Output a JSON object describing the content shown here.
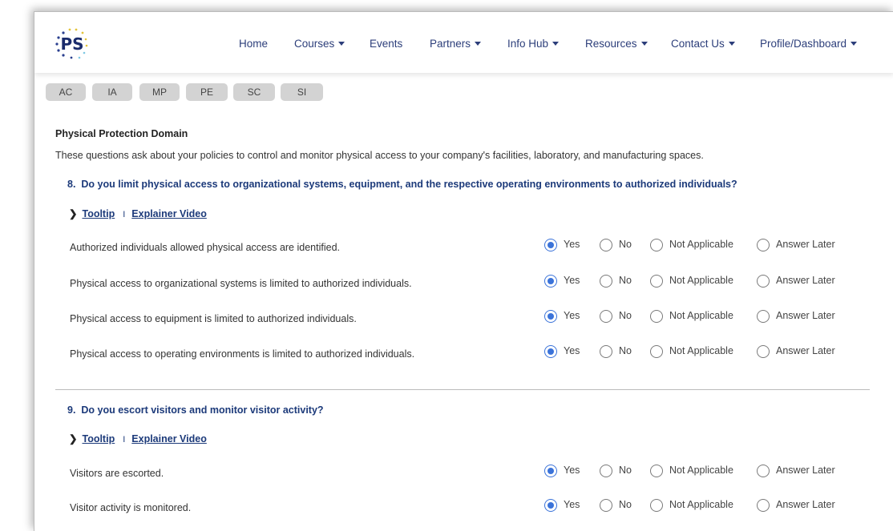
{
  "nav": {
    "logo_text": "PS",
    "items": [
      {
        "label": "Home",
        "dropdown": false
      },
      {
        "label": "Courses",
        "dropdown": true
      },
      {
        "label": "Events",
        "dropdown": false
      },
      {
        "label": "Partners",
        "dropdown": true
      },
      {
        "label": "Info Hub",
        "dropdown": true
      },
      {
        "label": "Resources",
        "dropdown": true
      },
      {
        "label": "Contact Us",
        "dropdown": true
      },
      {
        "label": "Profile/Dashboard",
        "dropdown": true
      }
    ]
  },
  "tabs": [
    "AC",
    "IA",
    "MP",
    "PE",
    "SC",
    "SI"
  ],
  "domain": {
    "title": "Physical Protection Domain",
    "description": "These questions ask about your policies to control and monitor physical access to your company's facilities, laboratory, and manufacturing spaces."
  },
  "options": [
    "Yes",
    "No",
    "Not Applicable",
    "Answer Later"
  ],
  "tooltip_label": "Tooltip",
  "video_label": "Explainer Video",
  "separator": "I",
  "questions": [
    {
      "number": "8.",
      "text": "Do you limit physical access to organizational systems, equipment, and the respective operating environments to authorized individuals?",
      "items": [
        {
          "label": "Authorized individuals allowed physical access are identified.",
          "selected": "Yes"
        },
        {
          "label": "Physical access to organizational systems is limited to authorized individuals.",
          "selected": "Yes"
        },
        {
          "label": "Physical access to equipment is limited to authorized individuals.",
          "selected": "Yes"
        },
        {
          "label": "Physical access to operating environments is limited to authorized individuals.",
          "selected": "Yes"
        }
      ]
    },
    {
      "number": "9.",
      "text": "Do you escort visitors and monitor visitor activity?",
      "items": [
        {
          "label": "Visitors are escorted.",
          "selected": "Yes"
        },
        {
          "label": "Visitor activity is monitored.",
          "selected": "Yes"
        }
      ]
    }
  ],
  "colors": {
    "accent": "#3b73d9",
    "heading": "#1c3a7a",
    "nav": "#2c3e7a",
    "tab_bg": "#d3d3d3"
  }
}
